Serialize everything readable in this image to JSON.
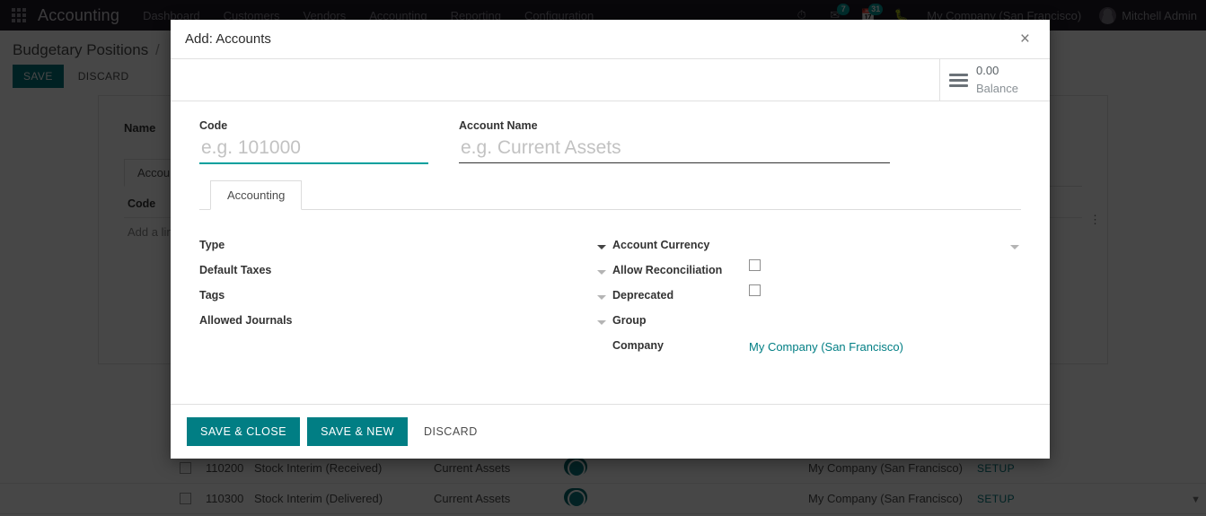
{
  "navbar": {
    "apps_icon": "apps-grid-icon",
    "brand": "Accounting",
    "menu": [
      "Dashboard",
      "Customers",
      "Vendors",
      "Accounting",
      "Reporting",
      "Configuration"
    ],
    "clock_icon": "clock-icon",
    "messages_icon": "messages-icon",
    "messages_count": "7",
    "activities_icon": "calendar-icon",
    "activities_count": "31",
    "debug_icon": "bug-icon",
    "company": "My Company (San Francisco)",
    "user": "Mitchell Admin",
    "avatar": "user-avatar"
  },
  "background": {
    "breadcrumb_root": "Budgetary Positions",
    "breadcrumb_sep": "/",
    "breadcrumb_current": "",
    "save_label": "SAVE",
    "discard_label": "DISCARD",
    "name_label": "Name",
    "tab_label": "Accounts",
    "col_code": "Code",
    "add_line": "Add a line",
    "ext_link_icon": "external-link-icon",
    "optional_columns_icon": "vertical-dots-icon",
    "scroll_arrow_icon": "chevron-down-icon",
    "rows": [
      {
        "code": "110200",
        "name": "Stock Interim (Received)",
        "type": "Current Assets",
        "allow_reconciliation": true,
        "company": "My Company (San Francisco)",
        "setup": "SETUP"
      },
      {
        "code": "110300",
        "name": "Stock Interim (Delivered)",
        "type": "Current Assets",
        "allow_reconciliation": true,
        "company": "My Company (San Francisco)",
        "setup": "SETUP"
      }
    ]
  },
  "modal": {
    "title": "Add: Accounts",
    "close_icon": "close-icon",
    "stat_button": {
      "icon": "bars-icon",
      "value": "0.00",
      "label": "Balance"
    },
    "code": {
      "label": "Code",
      "value": "",
      "placeholder": "e.g. 101000",
      "focused": true
    },
    "account_name": {
      "label": "Account Name",
      "value": "",
      "placeholder": "e.g. Current Assets"
    },
    "tabs": [
      {
        "label": "Accounting",
        "active": true
      }
    ],
    "fields_left": [
      {
        "label": "Type",
        "value": "",
        "widget": "dropdown",
        "required": true
      },
      {
        "label": "Default Taxes",
        "value": "",
        "widget": "dropdown",
        "required": false
      },
      {
        "label": "Tags",
        "value": "",
        "widget": "dropdown",
        "required": false
      },
      {
        "label": "Allowed Journals",
        "value": "",
        "widget": "dropdown",
        "required": false
      }
    ],
    "fields_right": [
      {
        "label": "Account Currency",
        "value": "",
        "widget": "dropdown",
        "required": false
      },
      {
        "label": "Allow Reconciliation",
        "value": "",
        "widget": "checkbox",
        "checked": false
      },
      {
        "label": "Deprecated",
        "value": "",
        "widget": "checkbox",
        "checked": false
      },
      {
        "label": "Group",
        "value": "",
        "widget": "text"
      },
      {
        "label": "Company",
        "value": "My Company (San Francisco)",
        "widget": "link"
      }
    ],
    "footer": {
      "save_close": "SAVE & CLOSE",
      "save_new": "SAVE & NEW",
      "discard": "DISCARD"
    }
  },
  "colors": {
    "accent_teal": "#017e84",
    "focus_teal": "#00a09d",
    "navbar_bg": "#1f1a24",
    "badge": "#00a09d"
  }
}
